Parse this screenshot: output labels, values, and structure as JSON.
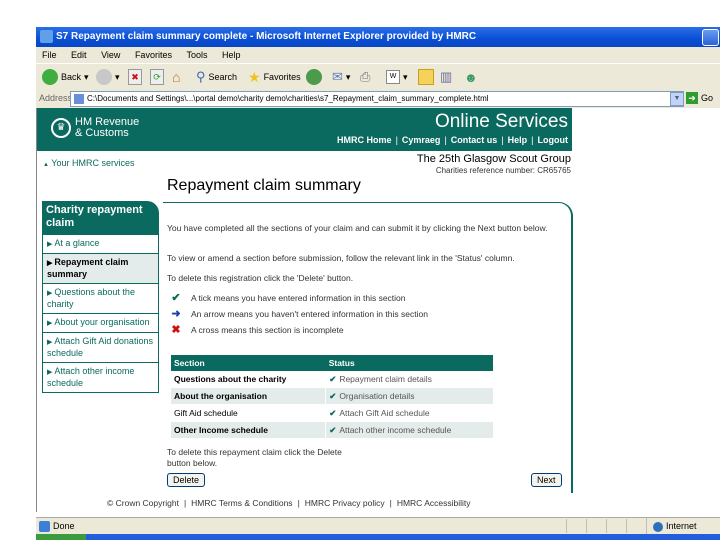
{
  "window": {
    "title": "S7 Repayment claim summary complete - Microsoft Internet Explorer provided by HMRC"
  },
  "menu": [
    "File",
    "Edit",
    "View",
    "Favorites",
    "Tools",
    "Help"
  ],
  "toolbar": {
    "back_label": "Back",
    "search_label": "Search",
    "favorites_label": "Favorites"
  },
  "address": {
    "label": "Address",
    "url": "C:\\Documents and Settings\\...\\portal demo\\charity demo\\charities\\s7_Repayment_claim_summary_complete.html",
    "go_label": "Go"
  },
  "header": {
    "logo_line1": "HM Revenue",
    "logo_line2": "& Customs",
    "service_title": "Online Services",
    "nav": [
      "HMRC Home",
      "Cymraeg",
      "Contact us",
      "Help",
      "Logout"
    ],
    "organisation": "The 25th Glasgow Scout Group",
    "charity_reference": "Charities reference number: CR65765",
    "your_services_link": "Your HMRC services"
  },
  "page_title": "Repayment claim summary",
  "sidebar": {
    "heading": "Charity repayment claim",
    "items": [
      {
        "label": "At a glance",
        "active": false
      },
      {
        "label": "Repayment claim summary",
        "active": true
      },
      {
        "label": "Questions about the charity",
        "active": false
      },
      {
        "label": "About your organisation",
        "active": false
      },
      {
        "label": "Attach Gift Aid donations schedule",
        "active": false
      },
      {
        "label": "Attach other income schedule",
        "active": false
      }
    ]
  },
  "main": {
    "intro": "You have completed all the sections of your claim and can submit it by clicking the Next button below.",
    "amend_text": "To view or amend a section before submission, follow the relevant link in the 'Status' column.",
    "delete_text": "To delete this registration click the 'Delete' button.",
    "legend": [
      {
        "icon": "tick",
        "text": "A tick means you have entered information in this section"
      },
      {
        "icon": "arrow",
        "text": "An arrow means you haven't entered information in this section"
      },
      {
        "icon": "cross",
        "text": "A cross means this section is incomplete"
      }
    ],
    "table": {
      "headers": [
        "Section",
        "Status"
      ],
      "rows": [
        {
          "section": "Questions about the charity",
          "status": "Repayment claim details",
          "state": "tick"
        },
        {
          "section": "About the organisation",
          "status": "Organisation details",
          "state": "tick"
        },
        {
          "section": "Gift Aid schedule",
          "status": "Attach Gift Aid schedule",
          "state": "tick"
        },
        {
          "section": "Other Income schedule",
          "status": "Attach other income schedule",
          "state": "tick"
        }
      ]
    },
    "delete_claim_text": "To delete this repayment claim click the Delete button below.",
    "delete_button": "Delete",
    "next_button": "Next"
  },
  "footer": [
    "© Crown Copyright",
    "HMRC Terms & Conditions",
    "HMRC Privacy policy",
    "HMRC Accessibility"
  ],
  "statusbar": {
    "status": "Done",
    "zone": "Internet"
  },
  "colors": {
    "brand": "#0b6a5f",
    "tick": "#0b6a5f",
    "arrow": "#1a3fb0",
    "cross": "#d01010"
  }
}
